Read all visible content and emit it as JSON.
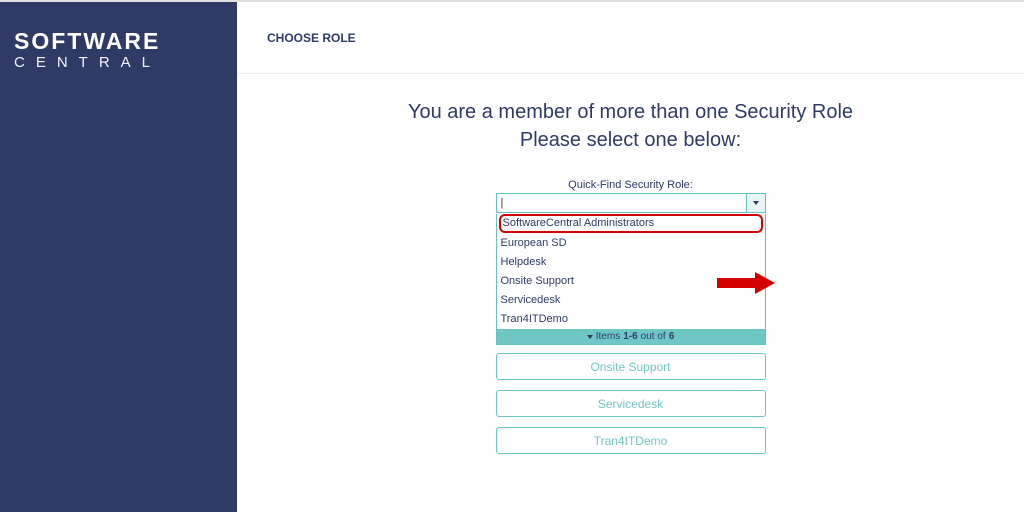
{
  "brand": {
    "line1": "SOFTWARE",
    "line2": "CENTRAL"
  },
  "topbar": {
    "title": "CHOOSE ROLE"
  },
  "headline": {
    "line1": "You are a member of more than one Security Role",
    "line2": "Please select one below:"
  },
  "quickfind": {
    "label": "Quick-Find Security Role:",
    "input_value": "|",
    "options": [
      "SoftwareCentral Administrators",
      "European SD",
      "Helpdesk",
      "Onsite Support",
      "Servicedesk",
      "Tran4ITDemo"
    ],
    "highlight_index": 0,
    "footer_prefix": "Items",
    "footer_range": "1-6",
    "footer_mid": "out of",
    "footer_total": "6"
  },
  "role_buttons": [
    "Onsite Support",
    "Servicedesk",
    "Tran4ITDemo"
  ],
  "colors": {
    "brand_navy": "#2f3b66",
    "accent_teal": "#6fc7c5",
    "callout_red": "#d40000"
  }
}
